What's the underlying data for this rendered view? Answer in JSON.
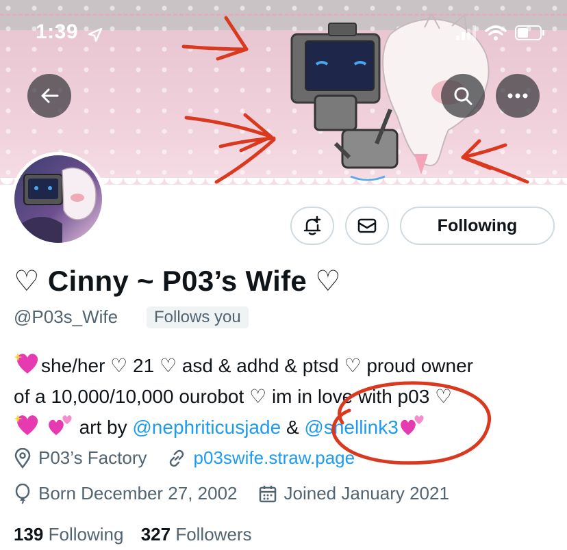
{
  "status_bar": {
    "time": "1:39"
  },
  "profile": {
    "name": "♡ Cinny ~ P03’s Wife ♡",
    "handle": "@P03s_Wife",
    "follows_you": "Follows you",
    "bio": {
      "line1": "she/her ♡ 21 ♡ asd & adhd & ptsd ♡ proud owner",
      "line2": "of a 10,000/10,000 ourobot ♡ im in love with p03 ♡",
      "art_by": "art by",
      "link1": "@nephriticusjade",
      "amp": "&",
      "link2": "@shellink3"
    },
    "location": "P03’s Factory",
    "website": "p03swife.straw.page",
    "born": "Born December 27, 2002",
    "joined": "Joined January 2021",
    "following_count": "139",
    "following_label": "Following",
    "followers_count": "327",
    "followers_label": "Followers"
  },
  "actions": {
    "follow_label": "Following"
  },
  "colors": {
    "link": "#1d9bf0",
    "annotation": "#d93a1f",
    "banner_pink": "#f1d3dd"
  },
  "icons": [
    "back-arrow-icon",
    "search-icon",
    "more-icon",
    "notification-bell-icon",
    "message-icon",
    "location-icon",
    "link-icon",
    "balloon-icon",
    "calendar-icon"
  ]
}
